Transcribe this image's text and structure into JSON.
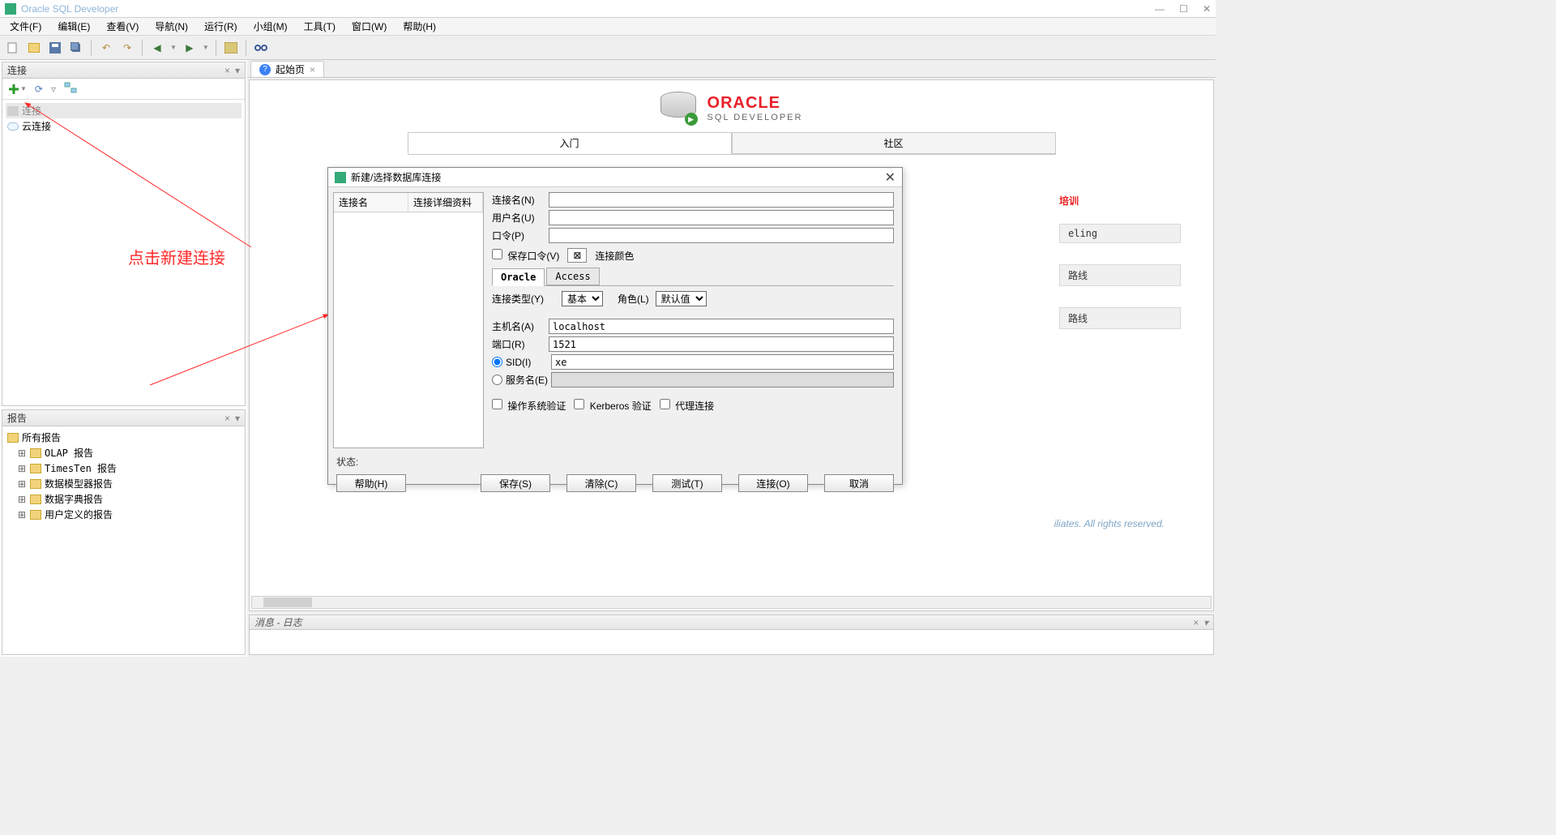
{
  "app": {
    "title": "Oracle SQL Developer"
  },
  "menu": {
    "file": "文件(F)",
    "edit": "编辑(E)",
    "view": "查看(V)",
    "nav": "导航(N)",
    "run": "运行(R)",
    "team": "小组(M)",
    "tools": "工具(T)",
    "window": "窗口(W)",
    "help": "帮助(H)"
  },
  "panels": {
    "connections_title": "连接",
    "reports_title": "报告",
    "messages_title": "消息 - 日志"
  },
  "conn_tree": {
    "root": "连接",
    "cloud": "云连接"
  },
  "reports_tree": {
    "all": "所有报告",
    "olap": "OLAP 报告",
    "timesten": "TimesTen 报告",
    "modeler": "数据模型器报告",
    "dict": "数据字典报告",
    "user": "用户定义的报告"
  },
  "start_tab": {
    "label": "起始页"
  },
  "oracle": {
    "brand": "ORACLE",
    "product": "SQL DEVELOPER"
  },
  "big_tabs": {
    "getting_started": "入门",
    "community": "社区"
  },
  "side": {
    "training": "培训",
    "link1": "eling",
    "link2": "路线",
    "link3": "路线"
  },
  "copyright": "iliates. All rights reserved.",
  "annotation": "点击新建连接",
  "dialog": {
    "title": "新建/选择数据库连接",
    "col_name": "连接名",
    "col_details": "连接详细资料",
    "lbl_conn_name": "连接名(N)",
    "lbl_user": "用户名(U)",
    "lbl_pass": "口令(P)",
    "chk_save_pass": "保存口令(V)",
    "lbl_conn_color": "连接颜色",
    "tab_oracle": "Oracle",
    "tab_access": "Access",
    "lbl_conn_type": "连接类型(Y)",
    "opt_basic": "基本",
    "lbl_role": "角色(L)",
    "opt_role_default": "默认值",
    "lbl_host": "主机名(A)",
    "val_host": "localhost",
    "lbl_port": "端口(R)",
    "val_port": "1521",
    "lbl_sid": "SID(I)",
    "val_sid": "xe",
    "lbl_service": "服务名(E)",
    "chk_os_auth": "操作系统验证",
    "chk_kerberos": "Kerberos 验证",
    "chk_proxy": "代理连接",
    "status_label": "状态:",
    "btn_help": "帮助(H)",
    "btn_save": "保存(S)",
    "btn_clear": "清除(C)",
    "btn_test": "测试(T)",
    "btn_connect": "连接(O)",
    "btn_cancel": "取消"
  }
}
